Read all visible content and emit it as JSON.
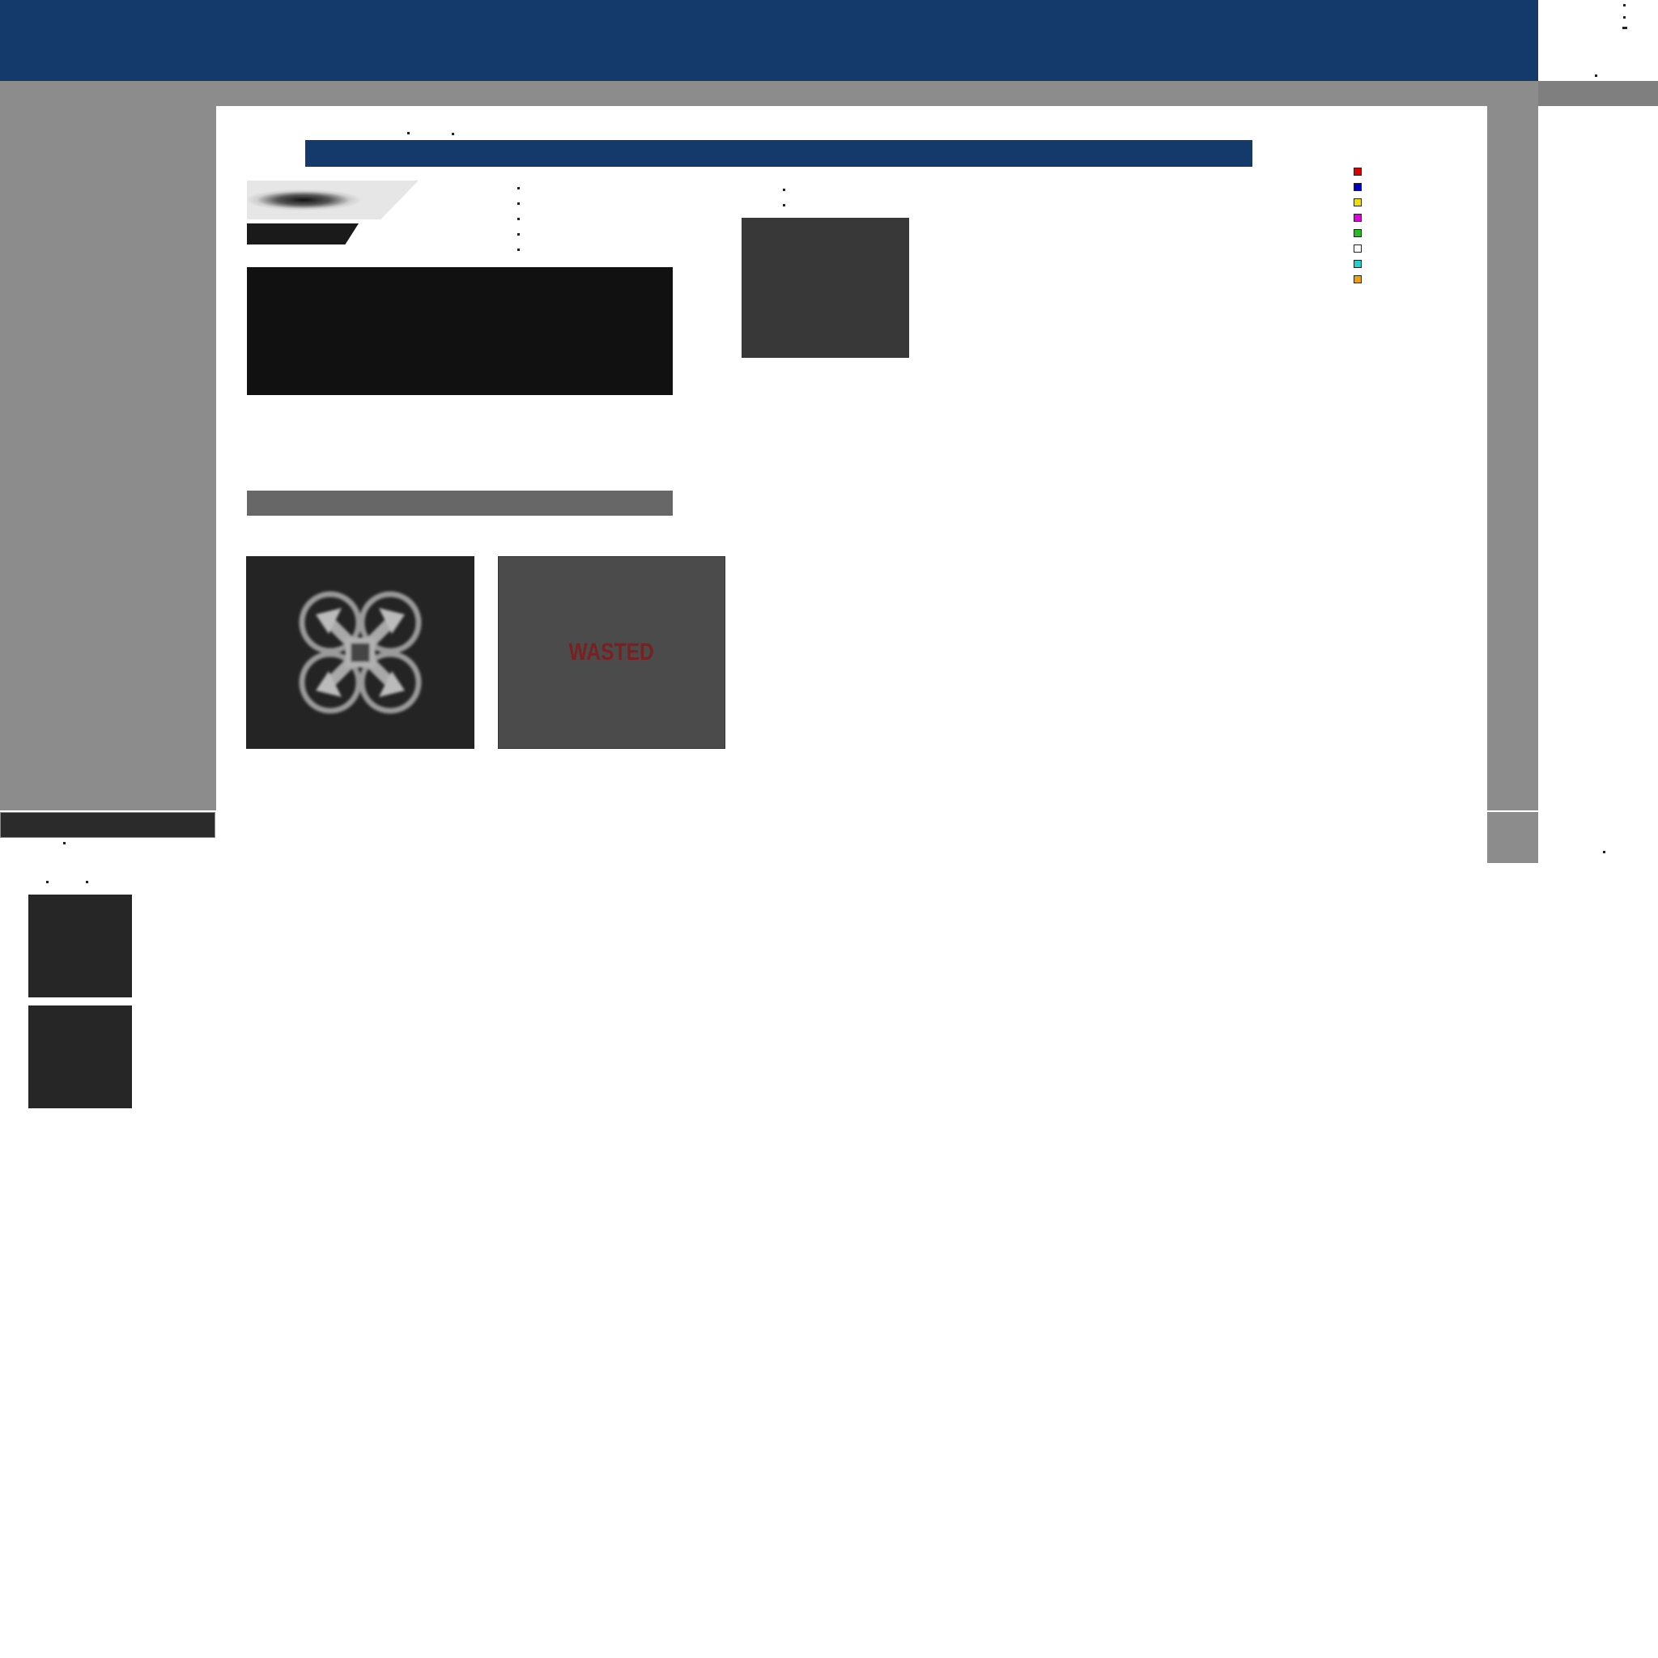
{
  "wasted_tile": {
    "label": "WASTED",
    "label_color": "#7a2020"
  },
  "drone_tile": {
    "icon": "drone-icon"
  },
  "legend": {
    "swatches": [
      "#e00000",
      "#0000c8",
      "#f0e000",
      "#e000e0",
      "#20c020",
      "#ffffff",
      "#20d0d0",
      "#f0a000"
    ]
  },
  "colors": {
    "banner": "#133a6b",
    "frame": "#8c8c8c"
  }
}
